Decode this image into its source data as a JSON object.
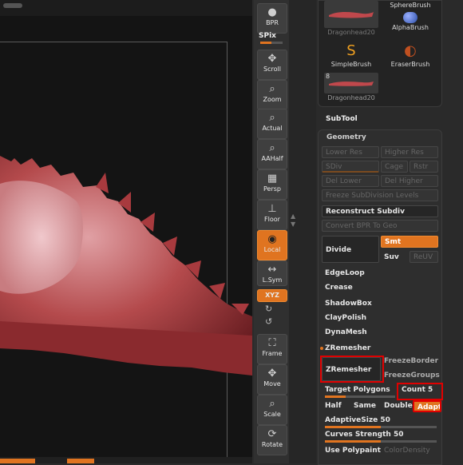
{
  "brushes": [
    {
      "name": "Dragonhead20",
      "thumb_color": "#c0484c"
    },
    {
      "name": "SphereBrush",
      "thumb_color": "#2c4ea8"
    },
    {
      "name": "AlphaBrush",
      "thumb_color": "#2a3fa0"
    },
    {
      "name": "SimpleBrush",
      "thumb_color": "#f0a020"
    },
    {
      "name": "EraserBrush",
      "thumb_color": "#c05020"
    },
    {
      "name": "Dragonhead20",
      "thumb_color": "#c0484c",
      "count": "8"
    }
  ],
  "shelf": {
    "bpr": "BPR",
    "spix": "SPix",
    "scroll": "Scroll",
    "zoom": "Zoom",
    "actual": "Actual",
    "aahalf": "AAHalf",
    "persp": "Persp",
    "floor": "Floor",
    "local": "Local",
    "lsym": "L.Sym",
    "xyz": "XYZ",
    "frame": "Frame",
    "move": "Move",
    "scale": "Scale",
    "rotate": "Rotate"
  },
  "subtool": "SubTool",
  "geometry": {
    "title": "Geometry",
    "lower_res": "Lower Res",
    "higher_res": "Higher Res",
    "sdiv": "SDiv",
    "cage": "Cage",
    "rstr": "Rstr",
    "del_lower": "Del Lower",
    "del_higher": "Del Higher",
    "freeze_subdiv": "Freeze SubDivision Levels",
    "reconstruct_subdiv": "Reconstruct Subdiv",
    "convert_bpr": "Convert BPR To Geo",
    "divide": "Divide",
    "smt": "Smt",
    "suv": "Suv",
    "reuv": "ReUV",
    "edgeloop": "EdgeLoop",
    "crease": "Crease",
    "shadowbox": "ShadowBox",
    "claypolish": "ClayPolish",
    "dynamesh": "DynaMesh",
    "zremesher_section": "ZRemesher",
    "zremesher_button": "ZRemesher",
    "freeze_border": "FreezeBorder",
    "freeze_groups": "FreezeGroups",
    "target_polygons": "Target Polygons",
    "count_label": "Count",
    "count_value": "5",
    "target_polygons_level": 0.3,
    "half": "Half",
    "same": "Same",
    "double": "Double",
    "adapt": "Adapt",
    "adaptive_size_label": "AdaptiveSize",
    "adaptive_size_value": "50",
    "adaptive_size_level": 0.5,
    "curves_strength_label": "Curves Strength",
    "curves_strength_value": "50",
    "curves_strength_level": 0.5,
    "use_polypaint": "Use Polypaint",
    "color_density": "ColorDensity"
  },
  "colors": {
    "accent": "#e07420",
    "highlight_box": "#e00000",
    "model": "#b44a4c"
  }
}
